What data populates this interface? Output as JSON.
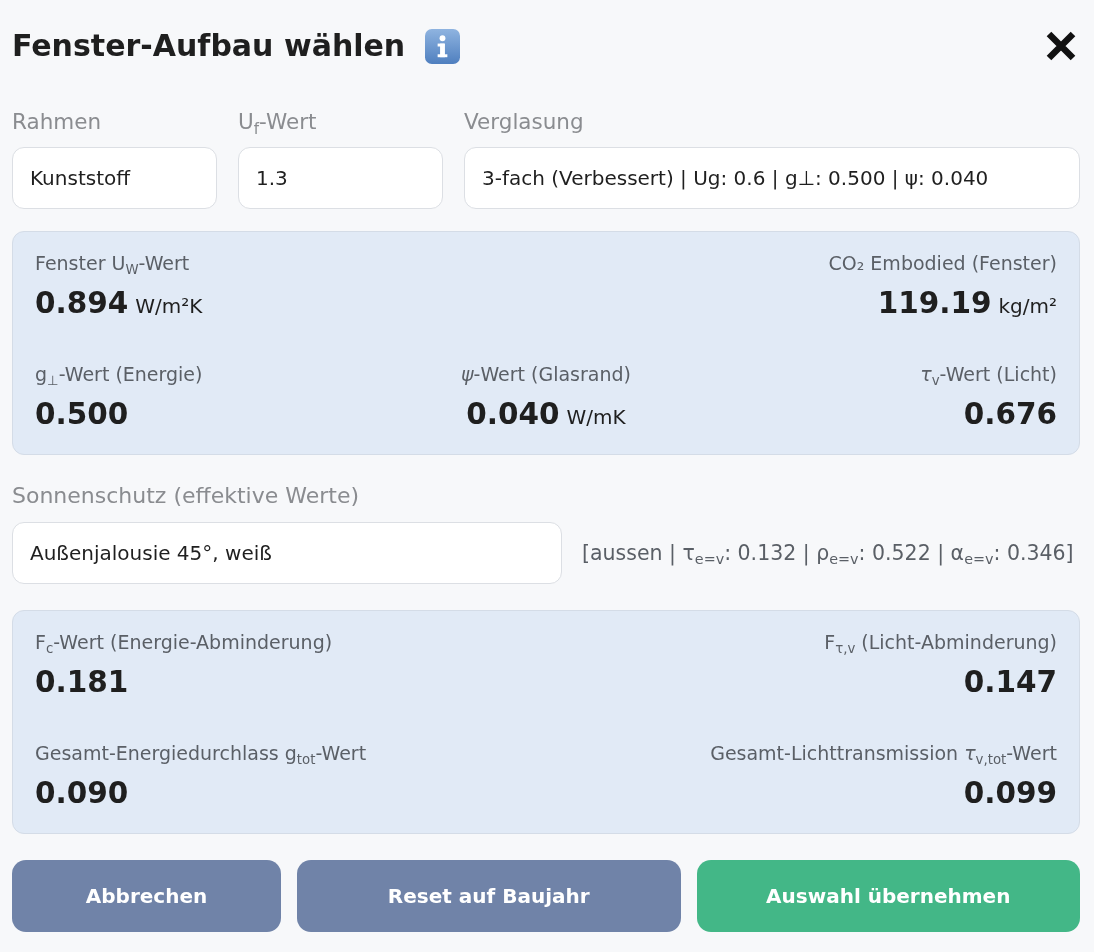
{
  "dialog": {
    "title": "Fenster-Aufbau wählen"
  },
  "fields": [
    {
      "label": "Rahmen",
      "value": "Kunststoff"
    },
    {
      "label": "U$_{f}$-Wert",
      "value": "1.3"
    },
    {
      "label": "Verglasung",
      "value": "3-fach (Verbessert) | Ug: 0.6 | g⊥: 0.500 | ψ: 0.040"
    }
  ],
  "window_panel": {
    "rows": [
      [
        {
          "label": "Fenster U$_{W}$-Wert",
          "value": "0.894",
          "unit": "W/m²K"
        },
        "",
        {
          "label": "CO₂ Embodied (Fenster)",
          "value": "119.19",
          "unit": "kg/m²"
        }
      ],
      [
        {
          "label": "g$_{⊥}$-Wert (Energie)",
          "value": "0.500"
        },
        {
          "label": "*ψ*-Wert (Glasrand)",
          "value": "0.040",
          "unit": "W/mK"
        },
        {
          "label": "*τ*$_{v}$-Wert (Licht)",
          "value": "0.676"
        }
      ]
    ]
  },
  "shading": {
    "label": "Sonnenschutz (effektive Werte)",
    "value": "Außenjalousie 45°, weiß",
    "details": "[aussen | τ$_{e=v}$: 0.132 | ρ$_{e=v}$: 0.522 | α$_{e=v}$: 0.346]"
  },
  "shading_panel": {
    "rows": [
      [
        {
          "label": "F$_{c}$-Wert (Energie-Abminderung)",
          "value": "0.181"
        },
        {
          "label": "F$_{τ,v}$ (Licht-Abminderung)",
          "value": "0.147"
        }
      ],
      [
        {
          "label": "Gesamt-Energiedurchlass g$_{tot}$-Wert",
          "value": "0.090"
        },
        {
          "label": "Gesamt-Lichttransmission *τ*$_{v,tot}$-Wert",
          "value": "0.099"
        }
      ]
    ]
  },
  "buttons": [
    {
      "label": "Abbrechen",
      "kind": "secondary"
    },
    {
      "label": "Reset auf Baujahr",
      "kind": "secondary"
    },
    {
      "label": "Auswahl übernehmen",
      "kind": "primary"
    }
  ]
}
